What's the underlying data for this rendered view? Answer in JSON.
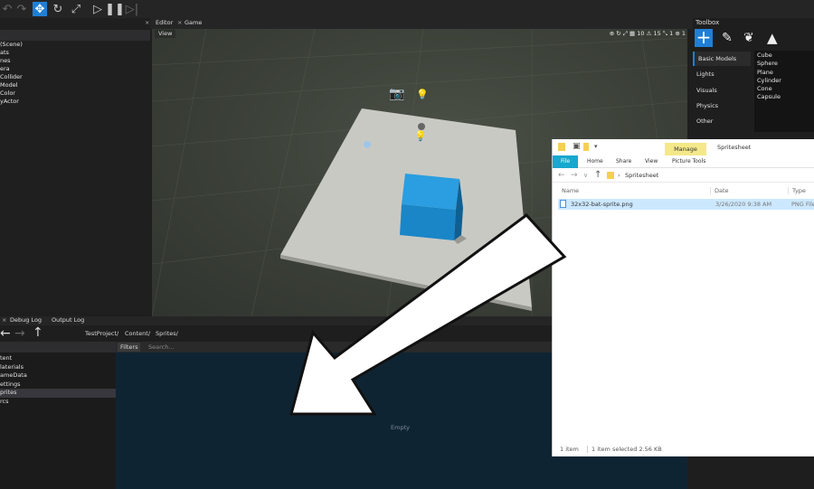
{
  "editor_tabs": {
    "editor": "Editor",
    "game": "Game",
    "close_glyph": "×"
  },
  "viewport": {
    "view_button": "View",
    "grid_size": "10",
    "camera_speed": "15",
    "stat_one": "1",
    "stat_two": "1"
  },
  "scene_tree": {
    "items": [
      "(Scene)",
      "ats",
      "nes",
      "era",
      "Collider",
      "Model",
      "Color",
      "yActor"
    ]
  },
  "toolbox": {
    "title": "Toolbox",
    "categories": [
      "Basic Models",
      "Lights",
      "Visuals",
      "Physics",
      "Other"
    ],
    "models": [
      "Cube",
      "Sphere",
      "Plane",
      "Cylinder",
      "Cone",
      "Capsule"
    ]
  },
  "bottom_tabs": {
    "close_glyph": "×",
    "debug_log": "Debug Log",
    "output_log": "Output Log"
  },
  "content": {
    "breadcrumb": [
      "TestProject/",
      "Content/",
      "Sprites/"
    ],
    "folders": [
      "tent",
      "laterials",
      "ameData",
      "ettings",
      "prites",
      "rcs"
    ],
    "selected_folder_index": 4,
    "filters_label": "Filters",
    "search_placeholder": "Search...",
    "empty_label": "Empty"
  },
  "explorer": {
    "manage": "Manage",
    "window_title": "Spritesheet",
    "ribbon": [
      "File",
      "Home",
      "Share",
      "View",
      "Picture Tools"
    ],
    "path": "Spritesheet",
    "columns": [
      "Name",
      "Date",
      "Type"
    ],
    "file": {
      "name": "32x32-bat-sprite.png",
      "date": "3/26/2020 9:38 AM",
      "type": "PNG File"
    },
    "status_count": "1 item",
    "status_selected": "1 item selected  2.56 KB"
  },
  "colors": {
    "accent": "#1f7fd6",
    "cube": "#1e88c9",
    "content_bg": "#0f2433"
  }
}
